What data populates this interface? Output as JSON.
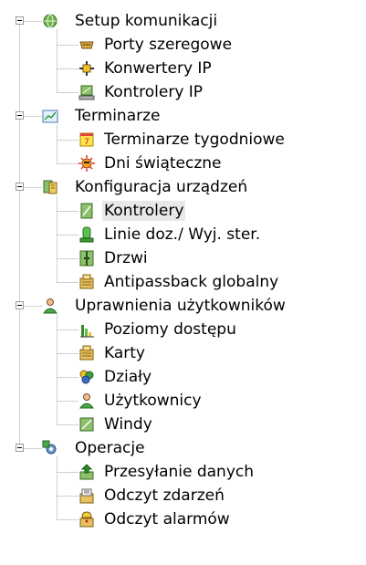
{
  "tree": {
    "groups": [
      {
        "label": "Setup komunikacji",
        "icon": "globe-network-icon",
        "children": [
          {
            "label": "Porty szeregowe",
            "icon": "serial-port-icon"
          },
          {
            "label": "Konwertery IP",
            "icon": "ip-converter-icon"
          },
          {
            "label": "Kontrolery IP",
            "icon": "ip-controller-icon"
          }
        ]
      },
      {
        "label": "Terminarze",
        "icon": "schedule-chart-icon",
        "children": [
          {
            "label": "Terminarze tygodniowe",
            "icon": "weekly-calendar-icon",
            "badge": "7"
          },
          {
            "label": "Dni świąteczne",
            "icon": "holiday-sun-icon"
          }
        ]
      },
      {
        "label": "Konfiguracja urządzeń",
        "icon": "device-config-icon",
        "children": [
          {
            "label": "Kontrolery",
            "icon": "controller-icon",
            "selected": true
          },
          {
            "label": "Linie doz./ Wyj. ster.",
            "icon": "line-output-icon"
          },
          {
            "label": "Drzwi",
            "icon": "door-icon"
          },
          {
            "label": "Antipassback globalny",
            "icon": "antipassback-icon"
          }
        ]
      },
      {
        "label": "Uprawnienia użytkowników",
        "icon": "users-permissions-icon",
        "children": [
          {
            "label": "Poziomy dostępu",
            "icon": "access-level-icon"
          },
          {
            "label": "Karty",
            "icon": "cards-icon"
          },
          {
            "label": "Działy",
            "icon": "departments-icon"
          },
          {
            "label": "Użytkownicy",
            "icon": "user-icon"
          },
          {
            "label": "Windy",
            "icon": "elevator-icon"
          }
        ]
      },
      {
        "label": "Operacje",
        "icon": "operations-gear-icon",
        "children": [
          {
            "label": "Przesyłanie danych",
            "icon": "data-transfer-icon"
          },
          {
            "label": "Odczyt zdarzeń",
            "icon": "read-events-icon"
          },
          {
            "label": "Odczyt alarmów",
            "icon": "read-alarms-icon"
          }
        ]
      }
    ],
    "colors": {
      "selected_bg": "#e8e8e8",
      "dotted_line": "#a0a0a0"
    }
  }
}
